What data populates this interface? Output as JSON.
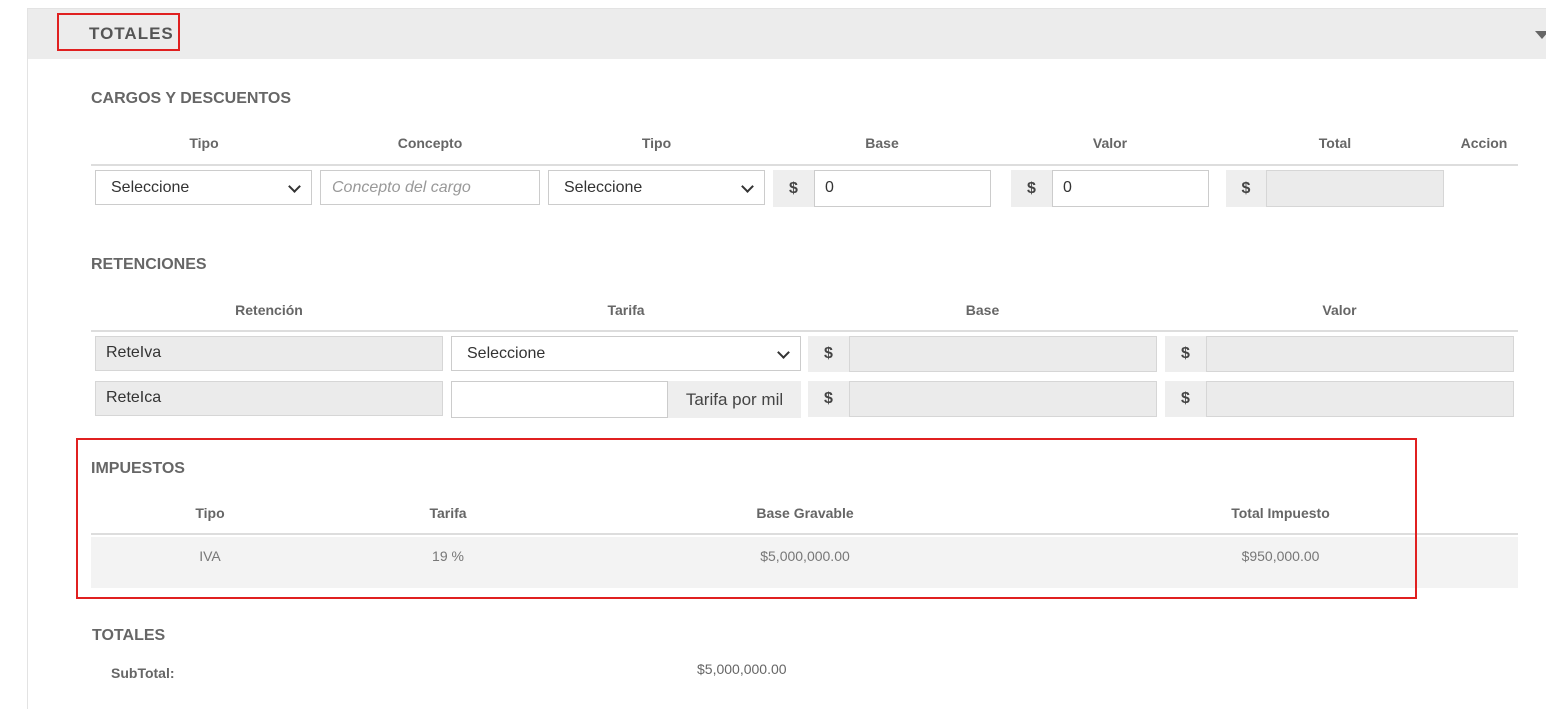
{
  "panel": {
    "title": "TOTALES",
    "collapse_icon": "caret-down-icon"
  },
  "cargos": {
    "title": "CARGOS Y DESCUENTOS",
    "headers": [
      "Tipo",
      "Concepto",
      "Tipo",
      "Base",
      "Valor",
      "Total",
      "Accion"
    ],
    "row": {
      "tipo1": "Seleccione",
      "concepto_placeholder": "Concepto del cargo",
      "tipo2": "Seleccione",
      "currency": "$",
      "base": "0",
      "valor": "0",
      "total": ""
    }
  },
  "retenciones": {
    "title": "RETENCIONES",
    "headers": [
      "Retención",
      "Tarifa",
      "Base",
      "Valor"
    ],
    "rows": [
      {
        "retencion": "ReteIva",
        "tarifa_select": "Seleccione",
        "base": "",
        "valor": ""
      },
      {
        "retencion": "ReteIca",
        "tarifa_input": "",
        "tarifa_addon": "Tarifa por mil",
        "base": "",
        "valor": ""
      }
    ],
    "currency": "$"
  },
  "impuestos": {
    "title": "IMPUESTOS",
    "headers": [
      "Tipo",
      "Tarifa",
      "Base Gravable",
      "Total Impuesto"
    ],
    "rows": [
      {
        "tipo": "IVA",
        "tarifa": "19 %",
        "base_gravable": "$5,000,000.00",
        "total_impuesto": "$950,000.00"
      }
    ]
  },
  "totales": {
    "title": "TOTALES",
    "subtotal_label": "SubTotal:",
    "subtotal_value": "$5,000,000.00"
  },
  "colors": {
    "highlight": "#e02020",
    "header_bg": "#ececec"
  }
}
